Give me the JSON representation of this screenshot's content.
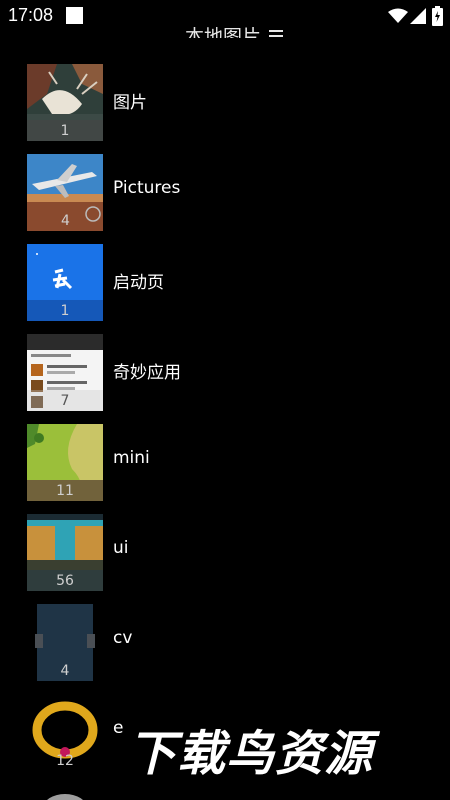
{
  "status_bar": {
    "time": "17:08"
  },
  "title": "本地图片",
  "albums": [
    {
      "name": "图片",
      "count": "1"
    },
    {
      "name": "Pictures",
      "count": "4"
    },
    {
      "name": "启动页",
      "count": "1"
    },
    {
      "name": "奇妙应用",
      "count": "7"
    },
    {
      "name": "mini",
      "count": "11"
    },
    {
      "name": "ui",
      "count": "56"
    },
    {
      "name": "cv",
      "count": "4"
    },
    {
      "name": "e",
      "count": "12"
    }
  ],
  "watermark": "下载鸟资源"
}
